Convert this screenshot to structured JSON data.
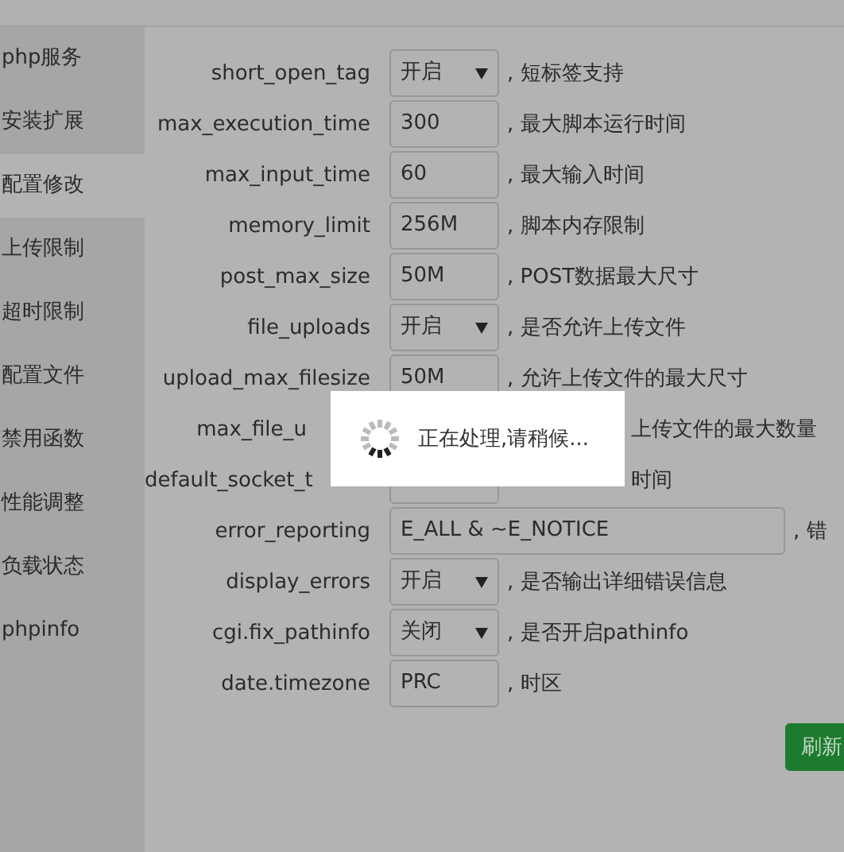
{
  "sidebar": {
    "items": [
      {
        "label": "php服务",
        "selected": false
      },
      {
        "label": "安装扩展",
        "selected": false
      },
      {
        "label": "配置修改",
        "selected": true
      },
      {
        "label": "上传限制",
        "selected": false
      },
      {
        "label": "超时限制",
        "selected": false
      },
      {
        "label": "配置文件",
        "selected": false
      },
      {
        "label": "禁用函数",
        "selected": false
      },
      {
        "label": "性能调整",
        "selected": false
      },
      {
        "label": "负载状态",
        "selected": false
      },
      {
        "label": "phpinfo",
        "selected": false
      }
    ]
  },
  "settings": [
    {
      "kind": "select",
      "name": "short_open_tag",
      "value": "开启",
      "note": ", 短标签支持"
    },
    {
      "kind": "input",
      "name": "max_execution_time",
      "value": "300",
      "note": ", 最大脚本运行时间"
    },
    {
      "kind": "input",
      "name": "max_input_time",
      "value": "60",
      "note": ", 最大输入时间"
    },
    {
      "kind": "input",
      "name": "memory_limit",
      "value": "256M",
      "note": ", 脚本内存限制"
    },
    {
      "kind": "input",
      "name": "post_max_size",
      "value": "50M",
      "note": ", POST数据最大尺寸"
    },
    {
      "kind": "select",
      "name": "file_uploads",
      "value": "开启",
      "note": ", 是否允许上传文件"
    },
    {
      "kind": "input",
      "name": "upload_max_filesize",
      "value": "50M",
      "note": ", 允许上传文件的最大尺寸"
    },
    {
      "kind": "covered",
      "name": "max_file_u",
      "note": "上传文件的最大数量"
    },
    {
      "kind": "partial",
      "name": "default_socket_t",
      "note": "时间"
    },
    {
      "kind": "wide",
      "name": "error_reporting",
      "value": "E_ALL & ~E_NOTICE",
      "note": ", 错"
    },
    {
      "kind": "select",
      "name": "display_errors",
      "value": "开启",
      "note": ", 是否输出详细错误信息"
    },
    {
      "kind": "select",
      "name": "cgi.fix_pathinfo",
      "value": "关闭",
      "note": ", 是否开启pathinfo"
    },
    {
      "kind": "input",
      "name": "date.timezone",
      "value": "PRC",
      "note": ", 时区"
    }
  ],
  "refresh_button": "刷新",
  "loading": {
    "message": "正在处理,请稍候..."
  }
}
